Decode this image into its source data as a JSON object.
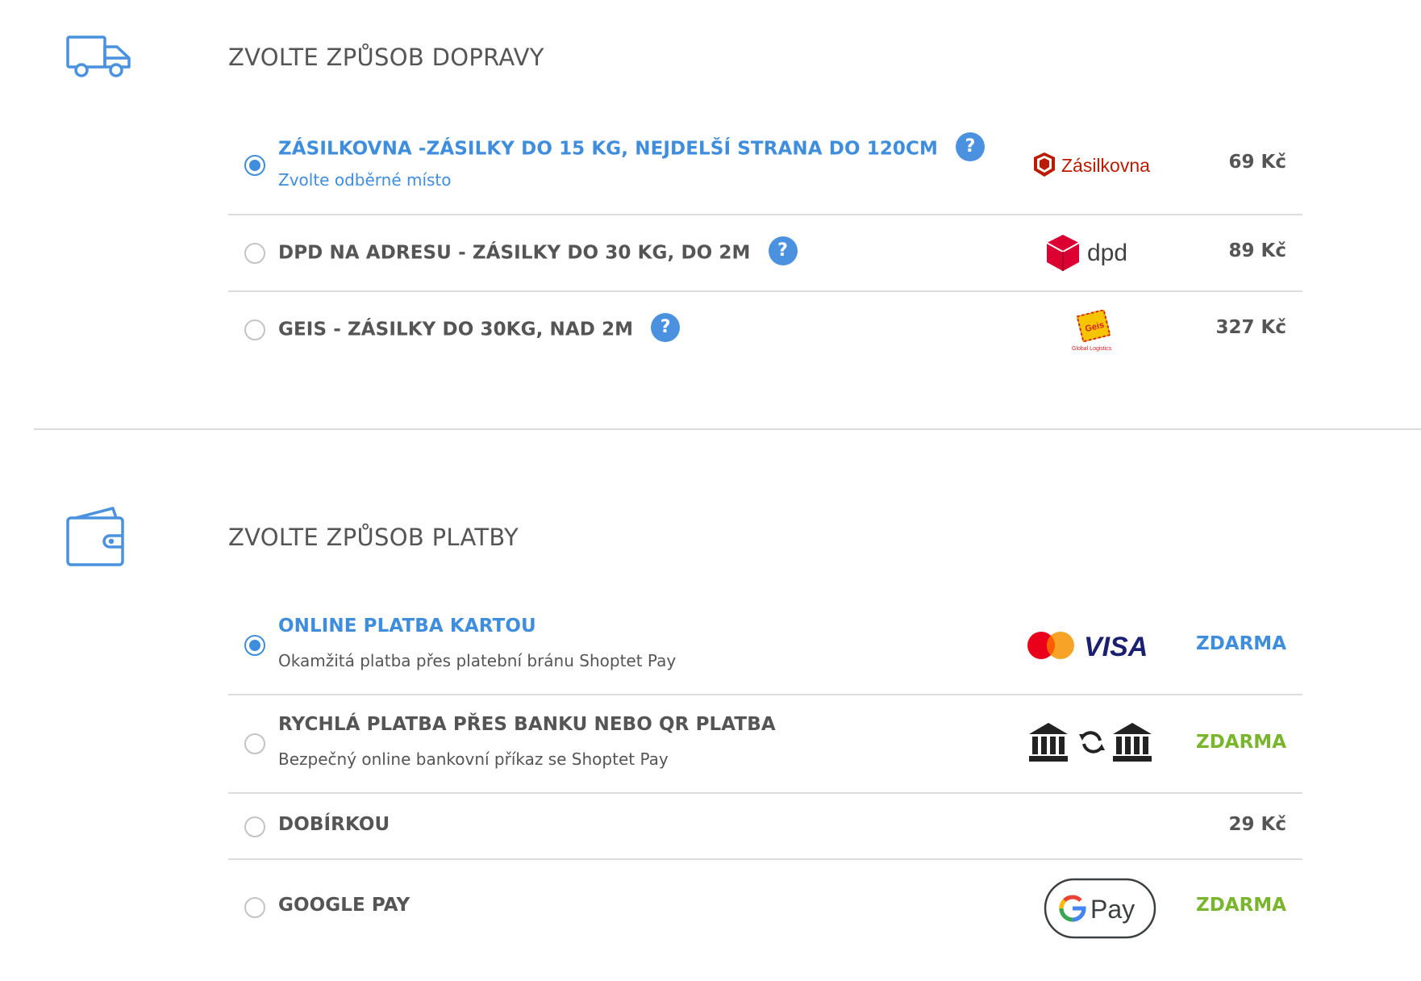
{
  "shipping": {
    "title": "ZVOLTE ZPŮSOB DOPRAVY",
    "icon": "truck-icon",
    "options": [
      {
        "title": "ZÁSILKOVNA -ZÁSILKY DO 15 KG, NEJDELŠÍ STRANA DO 120CM",
        "subtitle": "Zvolte odběrné místo",
        "price": "69 Kč",
        "selected": true,
        "help": "?",
        "logo": "zasilkovna-logo",
        "logo_text": "Zásilkovna"
      },
      {
        "title": "DPD NA ADRESU - ZÁSILKY DO 30 KG, DO 2M",
        "price": "89 Kč",
        "selected": false,
        "help": "?",
        "logo": "dpd-logo",
        "logo_text": "dpd"
      },
      {
        "title": "GEIS - ZÁSILKY DO 30KG, NAD 2M",
        "price": "327 Kč",
        "selected": false,
        "help": "?",
        "logo": "geis-logo",
        "logo_text": "Geis",
        "logo_subtext": "Global Logistics"
      }
    ]
  },
  "payment": {
    "title": "ZVOLTE ZPŮSOB PLATBY",
    "icon": "wallet-icon",
    "options": [
      {
        "title": "ONLINE PLATBA KARTOU",
        "subtitle": "Okamžitá platba přes platební bránu Shoptet Pay",
        "price": "ZDARMA",
        "selected": true,
        "logo": "mastercard-visa-logo",
        "logo_text": "VISA"
      },
      {
        "title": "RYCHLÁ PLATBA PŘES BANKU NEBO QR PLATBA",
        "subtitle": "Bezpečný online bankovní příkaz se Shoptet Pay",
        "price": "ZDARMA",
        "selected": false,
        "logo": "bank-transfer-icon"
      },
      {
        "title": "DOBÍRKOU",
        "price": "29 Kč",
        "selected": false
      },
      {
        "title": "GOOGLE PAY",
        "price": "ZDARMA",
        "selected": false,
        "logo": "google-pay-logo",
        "logo_text": "Pay"
      }
    ]
  },
  "colors": {
    "accent": "#3f8ddd",
    "free_green": "#7ab62d",
    "text": "#555555",
    "divider": "#dcdcdc"
  }
}
